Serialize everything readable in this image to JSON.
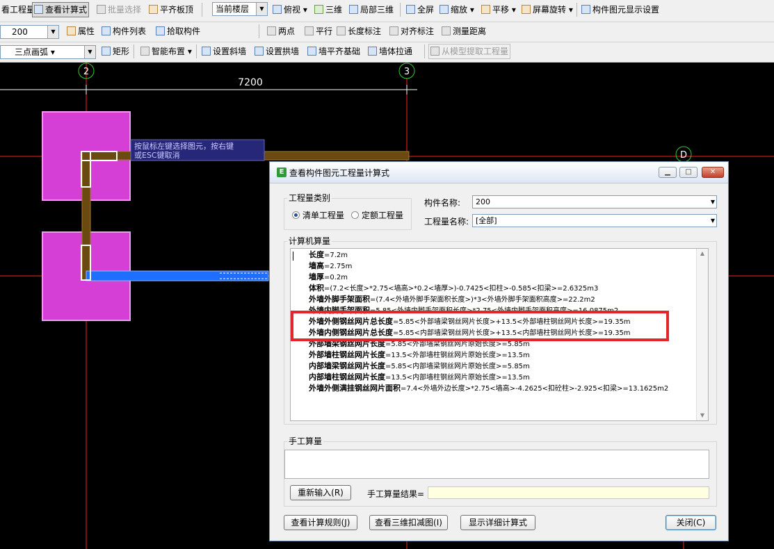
{
  "toolbar1": {
    "project_qty": "看工程量",
    "view_formula": "查看计算式",
    "batch_select": "批量选择",
    "flush_slab_top": "平齐板顶",
    "floor_select": "当前楼层",
    "top_view": "俯视",
    "three_d": "三维",
    "local_3d": "局部三维",
    "full_screen": "全屏",
    "zoom": "缩放",
    "pan": "平移",
    "screen_rotate": "屏幕旋转",
    "element_display": "构件图元显示设置"
  },
  "toolbar2": {
    "size_value": "200",
    "properties": "属性",
    "component_list": "构件列表",
    "pick_component": "拾取构件",
    "two_points": "两点",
    "parallel": "平行",
    "length_dim": "长度标注",
    "align_dim": "对齐标注",
    "measure_distance": "测量距离"
  },
  "toolbar3": {
    "arc_mode": "三点画弧",
    "rectangle": "矩形",
    "smart_layout": "智能布置",
    "set_slope_wall": "设置斜墙",
    "set_arch_wall": "设置拱墙",
    "wall_flush_foundation": "墙平齐基础",
    "wall_stretch": "墙体拉通",
    "extract_from_model": "从模型提取工程量"
  },
  "canvas": {
    "axis_2": "2",
    "axis_3": "3",
    "axis_d": "D",
    "dimension": "7200",
    "tooltip_line1": "按鼠标左键选择图元，按右键",
    "tooltip_line2": "或ESC键取消"
  },
  "dialog": {
    "title": "查看构件图元工程量计算式",
    "qty_type_label": "工程量类别",
    "radio_list_qty": "清单工程量",
    "radio_quota_qty": "定额工程量",
    "component_name_label": "构件名称:",
    "component_name_value": "200",
    "qty_name_label": "工程量名称:",
    "qty_name_value": "[全部]",
    "computer_calc_label": "计算机算量",
    "calc_lines": [
      {
        "name": "长度",
        "formula": "=7.2m"
      },
      {
        "name": "墙高",
        "formula": "=2.75m"
      },
      {
        "name": "墙厚",
        "formula": "=0.2m"
      },
      {
        "name": "体积",
        "formula": "=(7.2<长度>*2.75<墙高>*0.2<墙厚>)-0.7425<扣柱>-0.585<扣梁>=2.6325m3"
      },
      {
        "name": "外墙外脚手架面积",
        "formula": "=(7.4<外墙外脚手架面积长度>)*3<外墙外脚手架面积高度>=22.2m2"
      },
      {
        "name": "外墙内脚手架面积",
        "formula": "=5.85<外墙内脚手架面积长度>*2.75<外墙内脚手架面积高度>=16.0875m2"
      },
      {
        "name": "外墙外侧钢丝网片总长度",
        "formula": "=5.85<外部墙梁钢丝网片长度>+13.5<外部墙柱钢丝网片长度>=19.35m"
      },
      {
        "name": "外墙内侧钢丝网片总长度",
        "formula": "=5.85<内部墙梁钢丝网片长度>+13.5<内部墙柱钢丝网片长度>=19.35m"
      },
      {
        "name": "外部墙梁钢丝网片长度",
        "formula": "=5.85<外部墙梁钢丝网片原始长度>=5.85m"
      },
      {
        "name": "外部墙柱钢丝网片长度",
        "formula": "=13.5<外部墙柱钢丝网片原始长度>=13.5m"
      },
      {
        "name": "内部墙梁钢丝网片长度",
        "formula": "=5.85<内部墙梁钢丝网片原始长度>=5.85m"
      },
      {
        "name": "内部墙柱钢丝网片长度",
        "formula": "=13.5<内部墙柱钢丝网片原始长度>=13.5m"
      },
      {
        "name": "外墙外侧满挂钢丝网片面积",
        "formula": "=7.4<外墙外边长度>*2.75<墙高>-4.2625<扣砼柱>-2.925<扣梁>=13.1625m2"
      }
    ],
    "manual_calc_label": "手工算量",
    "reenter_button": "重新输入(R)",
    "manual_result_label": "手工算量结果=",
    "view_rules_button": "查看计算规则(J)",
    "view_3d_deduct_button": "查看三维扣减图(I)",
    "show_detail_button": "显示详细计算式",
    "close_button": "关闭(C)"
  },
  "colors": {
    "highlight_box": "#e3262c",
    "column_fill": "#d63fd6",
    "selected_wall": "#1e6fff"
  }
}
